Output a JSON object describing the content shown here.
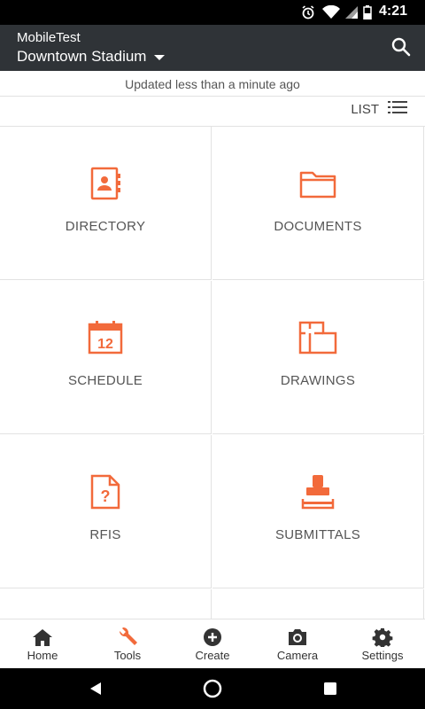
{
  "status_bar": {
    "time": "4:21"
  },
  "app_bar": {
    "org": "MobileTest",
    "project": "Downtown Stadium"
  },
  "updated_text": "Updated less than a minute ago",
  "view_toggle": {
    "label": "LIST"
  },
  "tools": [
    {
      "label": "DIRECTORY",
      "icon": "directory-icon"
    },
    {
      "label": "DOCUMENTS",
      "icon": "folder-icon"
    },
    {
      "label": "SCHEDULE",
      "icon": "calendar-icon",
      "icon_text": "12"
    },
    {
      "label": "DRAWINGS",
      "icon": "floorplan-icon"
    },
    {
      "label": "RFIS",
      "icon": "question-document-icon"
    },
    {
      "label": "SUBMITTALS",
      "icon": "stamp-icon"
    }
  ],
  "bottom_nav": [
    {
      "label": "Home",
      "icon": "home-icon"
    },
    {
      "label": "Tools",
      "icon": "wrench-icon"
    },
    {
      "label": "Create",
      "icon": "plus-circle-icon"
    },
    {
      "label": "Camera",
      "icon": "camera-icon"
    },
    {
      "label": "Settings",
      "icon": "gear-icon"
    }
  ],
  "colors": {
    "accent": "#f26a3b",
    "app_bar": "#2f3337",
    "status_bar": "#000000",
    "text": "#555555",
    "divider": "#e2e2e2"
  }
}
